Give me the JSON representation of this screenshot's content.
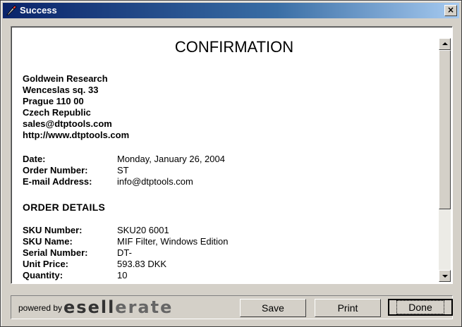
{
  "window": {
    "title": "Success",
    "close_label": "×"
  },
  "document": {
    "heading": "CONFIRMATION",
    "company_lines": [
      "Goldwein Research",
      "Wenceslas sq. 33",
      "Prague 110 00",
      "Czech Republic",
      "sales@dtptools.com",
      "http://www.dtptools.com"
    ],
    "info": [
      {
        "label": "Date:",
        "value": "Monday, January 26, 2004"
      },
      {
        "label": "Order Number:",
        "value": "ST"
      },
      {
        "label": "E-mail Address:",
        "value": "info@dtptools.com"
      }
    ],
    "section_title": "ORDER DETAILS",
    "details": [
      {
        "label": "SKU Number:",
        "value": "SKU20   6001"
      },
      {
        "label": "SKU Name:",
        "value": "MIF Filter, Windows Edition"
      },
      {
        "label": "Serial Number:",
        "value": "DT-"
      },
      {
        "label": "Unit Price:",
        "value": "593.83   DKK"
      },
      {
        "label": "Quantity:",
        "value": "10"
      }
    ]
  },
  "footer": {
    "powered_by": "powered by",
    "brand_part1": "esell",
    "brand_part2": "erate",
    "buttons": {
      "save": "Save",
      "print": "Print",
      "done": "Done"
    }
  }
}
